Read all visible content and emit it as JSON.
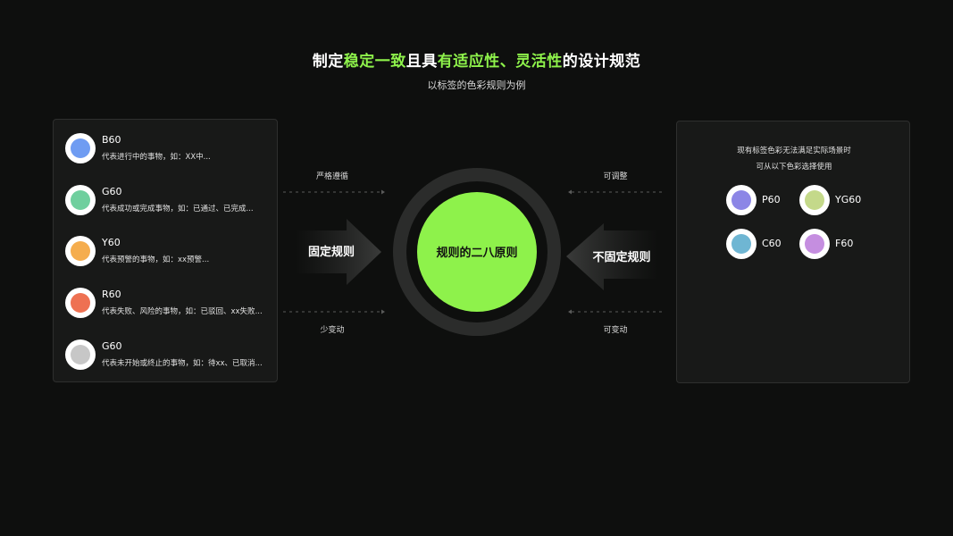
{
  "header": {
    "title_parts": [
      "制定",
      "稳定一致",
      "且具",
      "有适应性、灵活性",
      "的设计规范"
    ],
    "subtitle": "以标签的色彩规则为例"
  },
  "fixed_rules": {
    "items": [
      {
        "code": "B60",
        "desc": "代表进行中的事物，如：XX中...",
        "color": "#6f9cf2"
      },
      {
        "code": "G60",
        "desc": "代表成功或完成事物，如：已通过、已完成...",
        "color": "#6fcf9e"
      },
      {
        "code": "Y60",
        "desc": "代表预警的事物，如：xx预警...",
        "color": "#f5ad4e"
      },
      {
        "code": "R60",
        "desc": "代表失败、风险的事物，如：已驳回、xx失败...",
        "color": "#ee7152"
      },
      {
        "code": "G60",
        "desc": "代表未开始或终止的事物，如：待xx、已取消...",
        "color": "#c7c7c7"
      }
    ]
  },
  "flexible_rules": {
    "note_line1": "现有标签色彩无法满足实际场景时",
    "note_line2": "可从以下色彩选择使用",
    "swatches": [
      {
        "code": "P60",
        "color": "#8c86e6"
      },
      {
        "code": "YG60",
        "color": "#c4d98a"
      },
      {
        "code": "C60",
        "color": "#6fb6d3"
      },
      {
        "code": "F60",
        "color": "#c58ee0"
      }
    ]
  },
  "center": {
    "label": "规则的二八原则",
    "fill_color": "#8ef24b",
    "left_arrow_label": "固定规则",
    "right_arrow_label": "不固定规则",
    "left_top_caption": "严格遵循",
    "left_bottom_caption": "少变动",
    "right_top_caption": "可调整",
    "right_bottom_caption": "可变动"
  }
}
